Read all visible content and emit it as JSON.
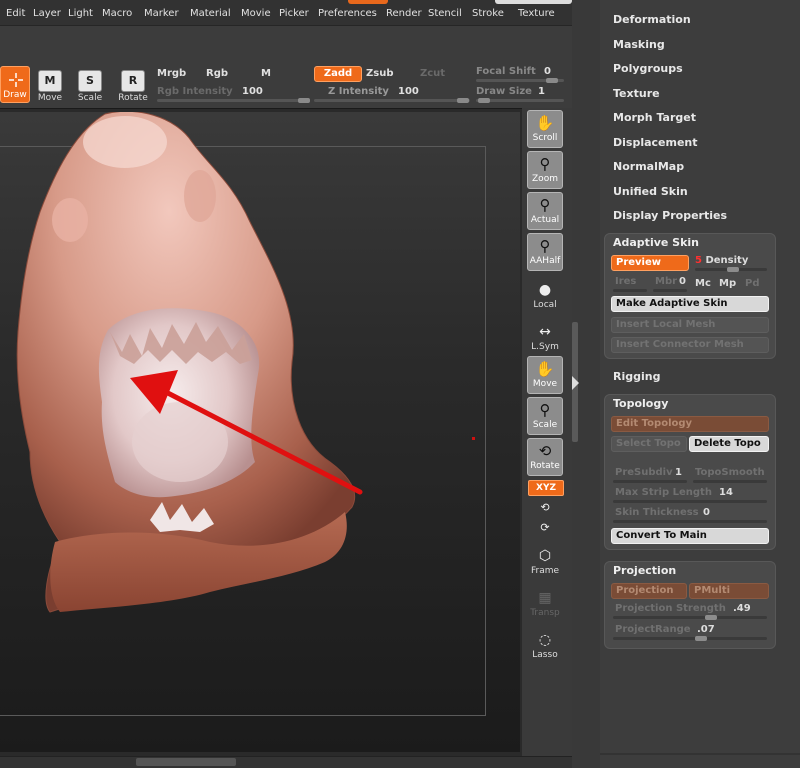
{
  "menubar": {
    "items": [
      "Edit",
      "Layer",
      "Light",
      "Macro",
      "Marker",
      "Material",
      "Movie",
      "Picker",
      "Preferences",
      "Render",
      "Stencil",
      "Stroke",
      "Texture"
    ],
    "partial_left": "pt"
  },
  "toolbar": {
    "draw": "Draw",
    "move": "Move",
    "scale": "Scale",
    "rotate": "Rotate",
    "mrgb": "Mrgb",
    "rgb": "Rgb",
    "m": "M",
    "rgb_intensity_label": "Rgb Intensity",
    "rgb_intensity_value": "100",
    "zadd": "Zadd",
    "zsub": "Zsub",
    "zcut": "Zcut",
    "z_intensity_label": "Z Intensity",
    "z_intensity_value": "100",
    "focal_shift_label": "Focal Shift",
    "focal_shift_value": "0",
    "draw_size_label": "Draw Size",
    "draw_size_value": "1",
    "icon_letters": {
      "move": "M",
      "scale": "S",
      "rotate": "R"
    }
  },
  "shelf": {
    "scroll": "Scroll",
    "zoom": "Zoom",
    "actual": "Actual",
    "aahalf": "AAHalf",
    "local": "Local",
    "lsym": "L.Sym",
    "move": "Move",
    "scale": "Scale",
    "rotate": "Rotate",
    "xyz": "XYZ",
    "frame": "Frame",
    "transp": "Transp",
    "lasso": "Lasso"
  },
  "tray": {
    "links": [
      "Deformation",
      "Masking",
      "Polygroups",
      "Texture",
      "Morph Target",
      "Displacement",
      "NormalMap",
      "Unified Skin",
      "Display Properties"
    ],
    "adaptive_skin": {
      "title": "Adaptive Skin",
      "preview": "Preview",
      "density_badge": "5",
      "density_label": "Density",
      "ires": "Ires",
      "mbr_label": "Mbr",
      "mbr_value": "0",
      "mc": "Mc",
      "mp": "Mp",
      "pd": "Pd",
      "make": "Make Adaptive Skin",
      "insert_local": "Insert Local Mesh",
      "insert_connector": "Insert Connector Mesh"
    },
    "rigging": "Rigging",
    "topology": {
      "title": "Topology",
      "edit": "Edit Topology",
      "select": "Select Topo",
      "delete": "Delete Topo",
      "presubdiv_label": "PreSubdiv",
      "presubdiv_value": "1",
      "toposmooth": "TopoSmooth",
      "max_strip_label": "Max Strip Length",
      "max_strip_value": "14",
      "skin_thickness_label": "Skin Thickness",
      "skin_thickness_value": "0",
      "convert": "Convert To Main"
    },
    "projection": {
      "title": "Projection",
      "projection_btn": "Projection",
      "pmulti": "PMulti",
      "strength_label": "Projection Strength",
      "strength_value": ".49",
      "range_label": "ProjectRange",
      "range_value": ".07"
    }
  },
  "colors": {
    "accent_orange": "#ef6a1a",
    "arrow_red": "#e01010",
    "model_skin": "#c98a7a",
    "background": "#3c3c3c"
  }
}
